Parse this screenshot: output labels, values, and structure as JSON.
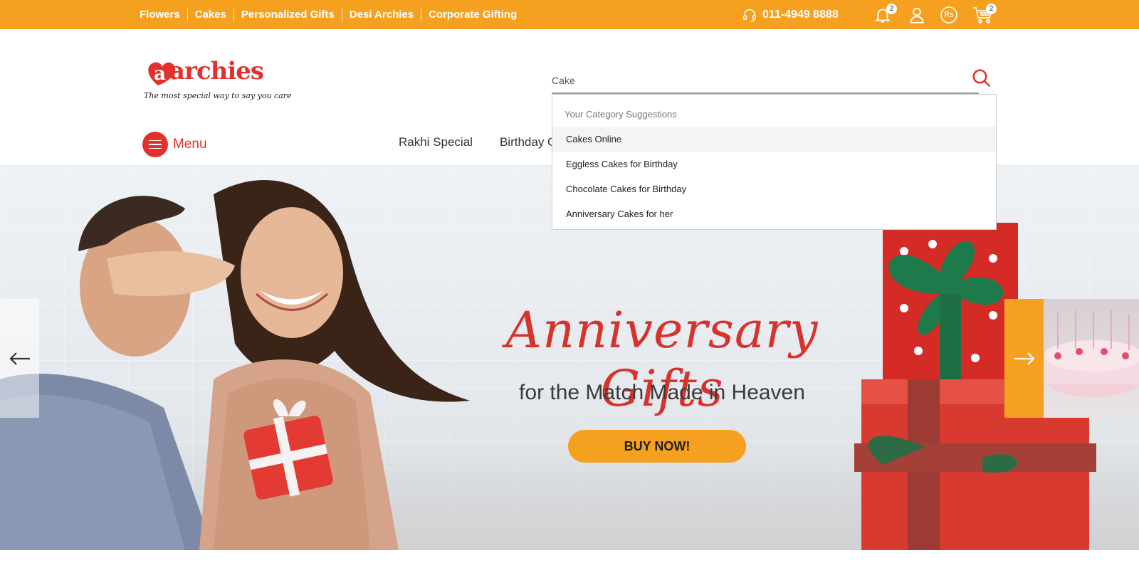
{
  "topbar": {
    "links": [
      "Flowers",
      "Cakes",
      "Personalized Gifts",
      "Desi Archies",
      "Corporate Gifting"
    ],
    "phone": "011-4949 8888",
    "notification_count": "2",
    "currency_label": "Rs",
    "cart_count": "2",
    "icons": [
      "headset-icon",
      "bell-icon",
      "user-icon",
      "currency-icon",
      "cart-icon"
    ]
  },
  "header": {
    "logo_text": "archies",
    "logo_tagline": "The most special way to say you care",
    "search_value": "Cake",
    "menu_label": "Menu",
    "nav": [
      "Rakhi Special",
      "Birthday G"
    ]
  },
  "suggestions": {
    "title": "Your Category Suggestions",
    "items": [
      "Cakes Online",
      "Eggless Cakes for Birthday",
      "Chocolate Cakes for Birthday",
      "Anniversary Cakes for her"
    ],
    "active_index": 0
  },
  "hero": {
    "title": "Anniversary Gifts",
    "subtitle": "for the Match Made in Heaven",
    "cta": "BUY NOW!"
  },
  "colors": {
    "brand_orange": "#f5a01e",
    "brand_red": "#e2312d",
    "title_red": "#d8322c"
  }
}
